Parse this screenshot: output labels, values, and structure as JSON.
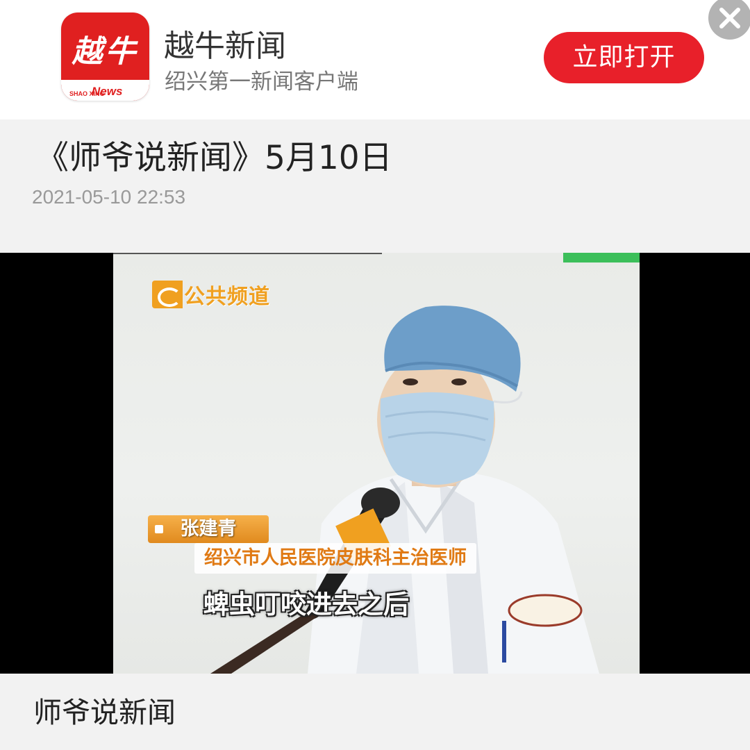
{
  "banner": {
    "app_name": "越牛新闻",
    "slogan": "绍兴第一新闻客户端",
    "open_label": "立即打开",
    "logo": {
      "chars": "越牛",
      "small_text": "SHAO XING",
      "news_text": "News",
      "color": "#e02020"
    },
    "close_icon": "close-icon"
  },
  "article": {
    "title": "《师爷说新闻》5月10日",
    "time": "2021-05-10 22:53"
  },
  "video": {
    "channel_logo": "公共频道",
    "person_name": "张建青",
    "person_title": "绍兴市人民医院皮肤科主治医师",
    "subtitle": "蜱虫叮咬进去之后",
    "accent_color": "#f0a020"
  },
  "footer": {
    "source": "师爷说新闻"
  }
}
